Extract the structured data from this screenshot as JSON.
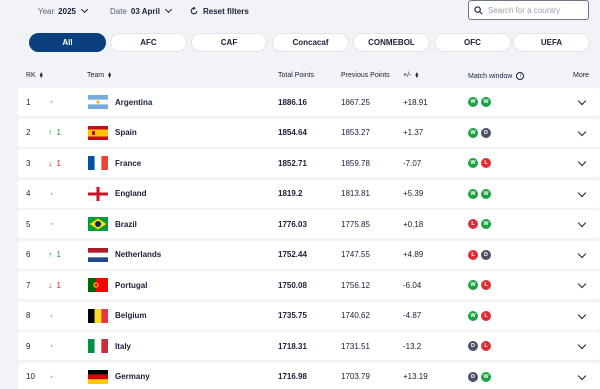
{
  "filters": {
    "year_label": "Year",
    "year_value": "2025",
    "date_label": "Date",
    "date_value": "03 April",
    "reset_label": "Reset filters",
    "search_placeholder": "Search for a country"
  },
  "tabs": [
    {
      "label": "All",
      "active": true
    },
    {
      "label": "AFC"
    },
    {
      "label": "CAF"
    },
    {
      "label": "Concacaf"
    },
    {
      "label": "CONMEBOL"
    },
    {
      "label": "OFC"
    },
    {
      "label": "UEFA"
    }
  ],
  "columns": {
    "rk": "RK",
    "team": "Team",
    "total_points": "Total Points",
    "previous_points": "Previous Points",
    "diff": "+/-",
    "match_window": "Match window",
    "more": "More"
  },
  "rows": [
    {
      "rank": "1",
      "move": "none",
      "move_value": "",
      "team": "Argentina",
      "flag": "argentina-flag",
      "total": "1886.16",
      "previous": "1867.25",
      "diff": "+18.91",
      "results": [
        "W",
        "W"
      ]
    },
    {
      "rank": "2",
      "move": "up",
      "move_value": "1",
      "team": "Spain",
      "flag": "spain-flag",
      "total": "1854.64",
      "previous": "1853.27",
      "diff": "+1.37",
      "results": [
        "W",
        "D"
      ]
    },
    {
      "rank": "3",
      "move": "down",
      "move_value": "1",
      "team": "France",
      "flag": "france-flag",
      "total": "1852.71",
      "previous": "1859.78",
      "diff": "-7.07",
      "results": [
        "W",
        "L"
      ]
    },
    {
      "rank": "4",
      "move": "none",
      "move_value": "",
      "team": "England",
      "flag": "england-flag",
      "total": "1819.2",
      "previous": "1813.81",
      "diff": "+5.39",
      "results": [
        "W",
        "W"
      ]
    },
    {
      "rank": "5",
      "move": "none",
      "move_value": "",
      "team": "Brazil",
      "flag": "brazil-flag",
      "total": "1776.03",
      "previous": "1775.85",
      "diff": "+0.18",
      "results": [
        "L",
        "W"
      ]
    },
    {
      "rank": "6",
      "move": "up",
      "move_value": "1",
      "team": "Netherlands",
      "flag": "netherlands-flag",
      "total": "1752.44",
      "previous": "1747.55",
      "diff": "+4.89",
      "results": [
        "L",
        "D"
      ]
    },
    {
      "rank": "7",
      "move": "down",
      "move_value": "1",
      "team": "Portugal",
      "flag": "portugal-flag",
      "total": "1750.08",
      "previous": "1756.12",
      "diff": "-6.04",
      "results": [
        "W",
        "L"
      ]
    },
    {
      "rank": "8",
      "move": "none",
      "move_value": "",
      "team": "Belgium",
      "flag": "belgium-flag",
      "total": "1735.75",
      "previous": "1740.62",
      "diff": "-4.87",
      "results": [
        "W",
        "L"
      ]
    },
    {
      "rank": "9",
      "move": "none",
      "move_value": "",
      "team": "Italy",
      "flag": "italy-flag",
      "total": "1718.31",
      "previous": "1731.51",
      "diff": "-13.2",
      "results": [
        "D",
        "L"
      ]
    },
    {
      "rank": "10",
      "move": "none",
      "move_value": "",
      "team": "Germany",
      "flag": "germany-flag",
      "total": "1716.98",
      "previous": "1703.79",
      "diff": "+13.19",
      "results": [
        "D",
        "W"
      ]
    }
  ],
  "colors": {
    "active_tab": "#0a3f80",
    "win": "#18a340",
    "draw": "#4a5066",
    "loss": "#dc2f35",
    "rank_up": "#188f3a",
    "rank_down": "#d3222a"
  }
}
